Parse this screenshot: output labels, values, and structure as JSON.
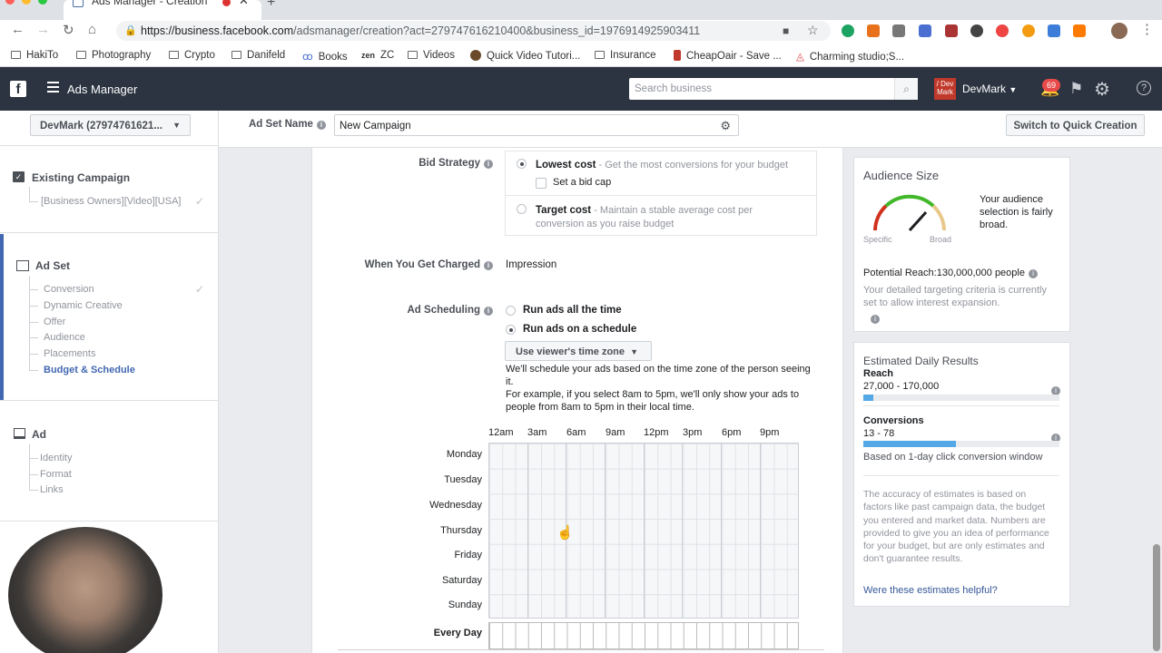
{
  "browser": {
    "tab_title": "Ads Manager - Creation",
    "url_host": "https://business.facebook.com",
    "url_path": "/adsmanager/creation?act=279747616210400&business_id=1976914925903411",
    "bookmarks": [
      "HakiTo",
      "Photography",
      "Crypto",
      "Danifeld",
      "Books",
      "ZC",
      "Videos",
      "Quick Video Tutori...",
      "Insurance",
      "CheapOair - Save ...",
      "Charming studio;S..."
    ],
    "zen_label": "zen"
  },
  "topbar": {
    "logo": "f",
    "app_name": "Ads Manager",
    "search_placeholder": "Search business",
    "account_avatar": "/ Dev Mark",
    "account_name": "DevMark",
    "notif_count": "69"
  },
  "leftnav": {
    "account_selector": "DevMark (27974761621...",
    "campaign_header": "Existing Campaign",
    "campaign_name": "[Business Owners][Video][USA]",
    "adset_header": "Ad Set",
    "adset_items": [
      "Conversion",
      "Dynamic Creative",
      "Offer",
      "Audience",
      "Placements",
      "Budget & Schedule"
    ],
    "ad_header": "Ad",
    "ad_items": [
      "Identity",
      "Format",
      "Links"
    ]
  },
  "subbar": {
    "adset_name_label": "Ad Set Name",
    "adset_name_value": "New Campaign",
    "switch_button": "Switch to Quick Creation"
  },
  "form": {
    "bid_strategy_label": "Bid Strategy",
    "lowest_cost_title": "Lowest cost",
    "lowest_cost_desc": " - Get the most conversions for your budget",
    "bid_cap_label": "Set a bid cap",
    "target_cost_title": "Target cost",
    "target_cost_desc": " - Maintain a stable average cost per conversion as you raise budget",
    "charged_label": "When You Get Charged",
    "charged_value": "Impression",
    "scheduling_label": "Ad Scheduling",
    "run_all_time": "Run ads all the time",
    "run_schedule": "Run ads on a schedule",
    "timezone_button": "Use viewer's time zone",
    "schedule_note_1": "We'll schedule your ads based on the time zone of the person seeing it.",
    "schedule_note_2": "For example, if you select 8am to 5pm, we'll only show your ads to people from 8am to 5pm in their local time.",
    "hours": [
      "12am",
      "3am",
      "6am",
      "9am",
      "12pm",
      "3pm",
      "6pm",
      "9pm"
    ],
    "days": [
      "Monday",
      "Tuesday",
      "Wednesday",
      "Thursday",
      "Friday",
      "Saturday",
      "Sunday"
    ],
    "every_day": "Every Day"
  },
  "audience": {
    "title": "Audience Size",
    "specific": "Specific",
    "broad": "Broad",
    "description": "Your audience selection is fairly broad.",
    "reach": "Potential Reach:130,000,000 people",
    "note": "Your detailed targeting criteria is currently set to allow interest expansion."
  },
  "estimates": {
    "title": "Estimated Daily Results",
    "reach_label": "Reach",
    "reach_value": "27,000 - 170,000",
    "reach_fill": 0.05,
    "conv_label": "Conversions",
    "conv_value": "13 - 78",
    "conv_fill": 0.47,
    "window_note": "Based on 1-day click conversion window",
    "accuracy_note": "The accuracy of estimates is based on factors like past campaign data, the budget you entered and market data. Numbers are provided to give you an idea of performance for your budget, but are only estimates and don't guarantee results.",
    "helpful_link": "Were these estimates helpful?"
  }
}
